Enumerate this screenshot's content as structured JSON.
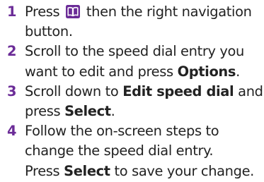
{
  "steps": [
    {
      "number": "1",
      "before_icon": "Press ",
      "icon": "phonebook-key-icon",
      "after_icon": " then the right navigation",
      "line2": "button."
    },
    {
      "number": "2",
      "line1": "Scroll to the speed dial entry you",
      "line2_pre": "want to edit and press ",
      "line2_bold": "Options",
      "line2_post": "."
    },
    {
      "number": "3",
      "line1_pre": "Scroll down to ",
      "line1_bold": "Edit speed dial",
      "line1_post": " and",
      "line2_pre": "press ",
      "line2_bold": "Select",
      "line2_post": "."
    },
    {
      "number": "4",
      "line1": "Follow the on-screen steps to",
      "line2": "change the speed dial entry.",
      "line3_pre": "Press ",
      "line3_bold": "Select",
      "line3_post": " to save your change."
    }
  ],
  "colors": {
    "step_number": "#6b2c97",
    "text": "#222222",
    "icon_fill": "#6b2c97"
  }
}
